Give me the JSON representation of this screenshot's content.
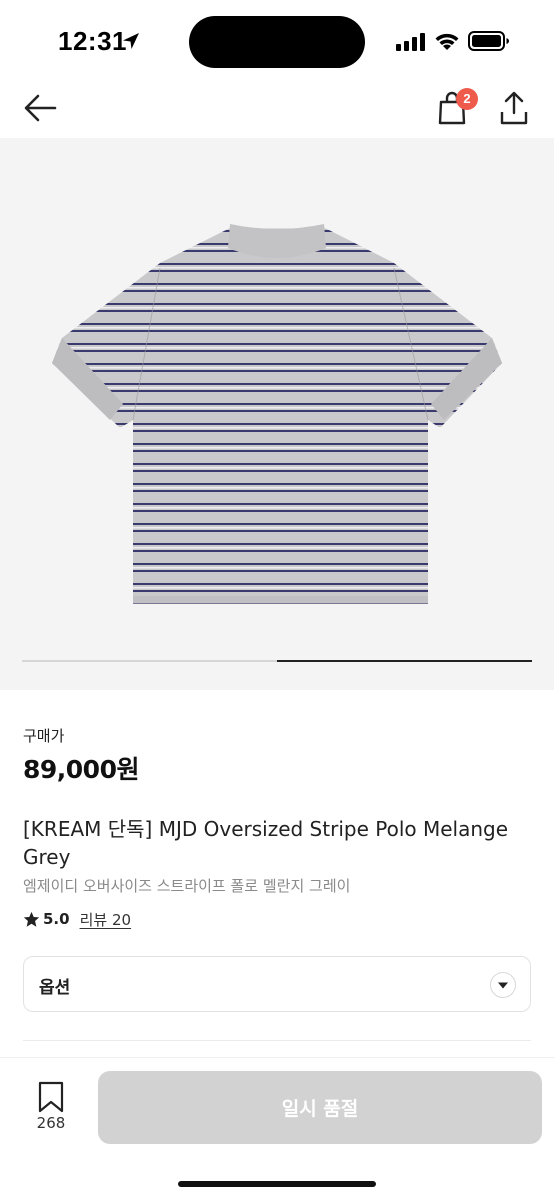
{
  "status_bar": {
    "time": "12:31",
    "icons": [
      "location-arrow-icon",
      "cellular-signal-icon",
      "wifi-icon",
      "battery-icon"
    ]
  },
  "nav": {
    "back_icon": "arrow-left-icon",
    "bag_icon": "shopping-bag-icon",
    "bag_badge": "2",
    "share_icon": "share-icon",
    "badge_color": "#ef5b4b"
  },
  "gallery": {
    "image": "grey and navy striped polo shirt, back view",
    "page_progress": 0.5
  },
  "product": {
    "price_label": "구매가",
    "price": "89,000원",
    "title": "[KREAM 단독] MJD Oversized Stripe Polo Melange Grey",
    "subtitle": "엠제이디 오버사이즈 스트라이프 폴로 멜란지 그레이",
    "rating": "5.0",
    "review_link": "리뷰 20"
  },
  "options": {
    "label": "옵션",
    "icon": "chevron-down-icon"
  },
  "bottom_bar": {
    "bookmark_icon": "bookmark-icon",
    "bookmark_count": "268",
    "soldout_label": "일시 품절",
    "button_color": "#d2d2d2"
  }
}
